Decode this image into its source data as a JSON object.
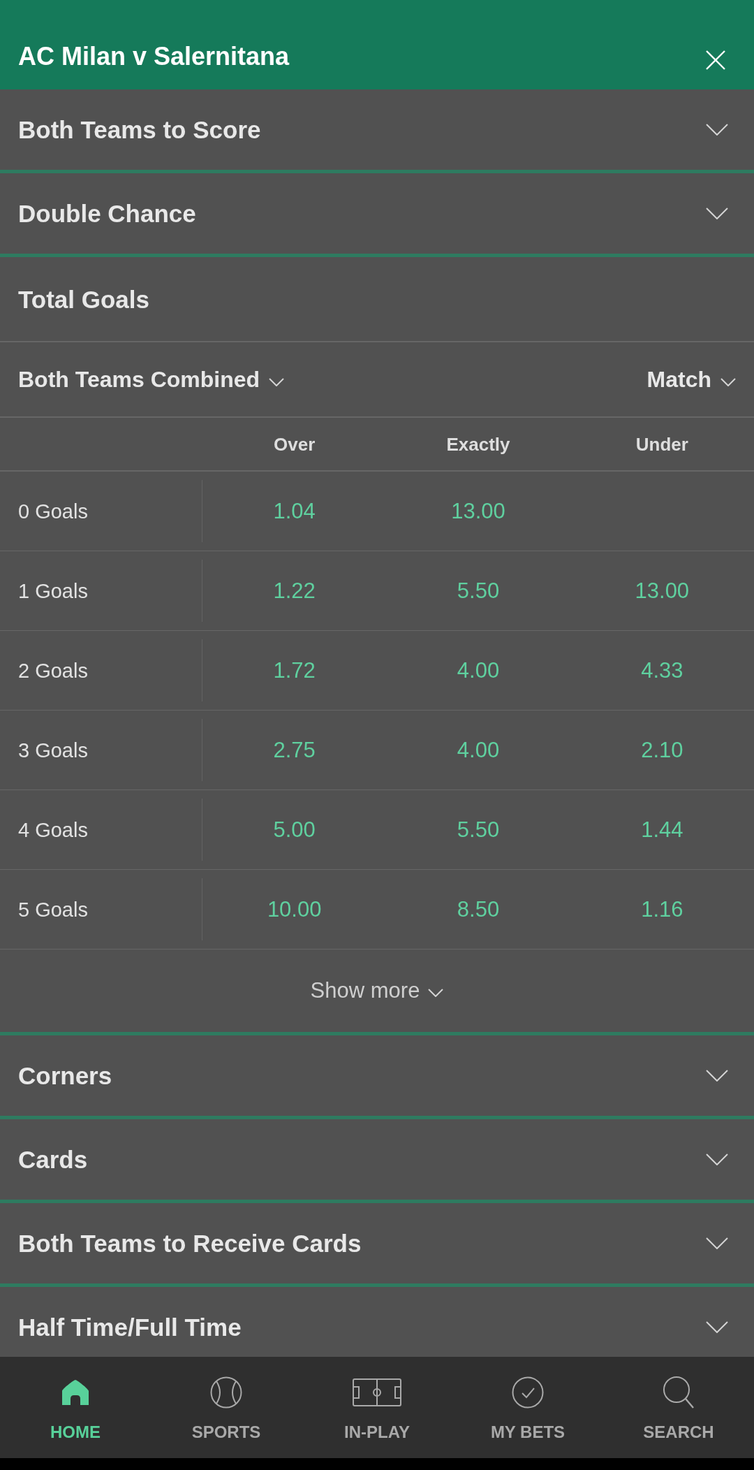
{
  "header": {
    "title": "AC Milan v Salernitana"
  },
  "markets": [
    {
      "title": "Both Teams to Score",
      "expanded": false
    },
    {
      "title": "Double Chance",
      "expanded": false
    },
    {
      "title": "Total Goals",
      "expanded": true,
      "filters": [
        "Both Teams Combined",
        "Match"
      ],
      "columns": [
        "Over",
        "Exactly",
        "Under"
      ],
      "rows": [
        {
          "label": "0 Goals",
          "odds": [
            "1.04",
            "13.00"
          ]
        },
        {
          "label": "1 Goals",
          "odds": [
            "1.22",
            "5.50",
            "13.00"
          ]
        },
        {
          "label": "2 Goals",
          "odds": [
            "1.72",
            "4.00",
            "4.33"
          ]
        },
        {
          "label": "3 Goals",
          "odds": [
            "2.75",
            "4.00",
            "2.10"
          ]
        },
        {
          "label": "4 Goals",
          "odds": [
            "5.00",
            "5.50",
            "1.44"
          ]
        },
        {
          "label": "5 Goals",
          "odds": [
            "10.00",
            "8.50",
            "1.16"
          ]
        }
      ],
      "show_more": "Show more"
    },
    {
      "title": "Corners",
      "expanded": false
    },
    {
      "title": "Cards",
      "expanded": false
    },
    {
      "title": "Both Teams to Receive Cards",
      "expanded": false
    },
    {
      "title": "Half Time/Full Time",
      "expanded": false
    }
  ],
  "nav": [
    {
      "label": "HOME",
      "selected": true
    },
    {
      "label": "SPORTS",
      "selected": false
    },
    {
      "label": "IN-PLAY",
      "selected": false
    },
    {
      "label": "MY BETS",
      "selected": false
    },
    {
      "label": "SEARCH",
      "selected": false
    }
  ]
}
